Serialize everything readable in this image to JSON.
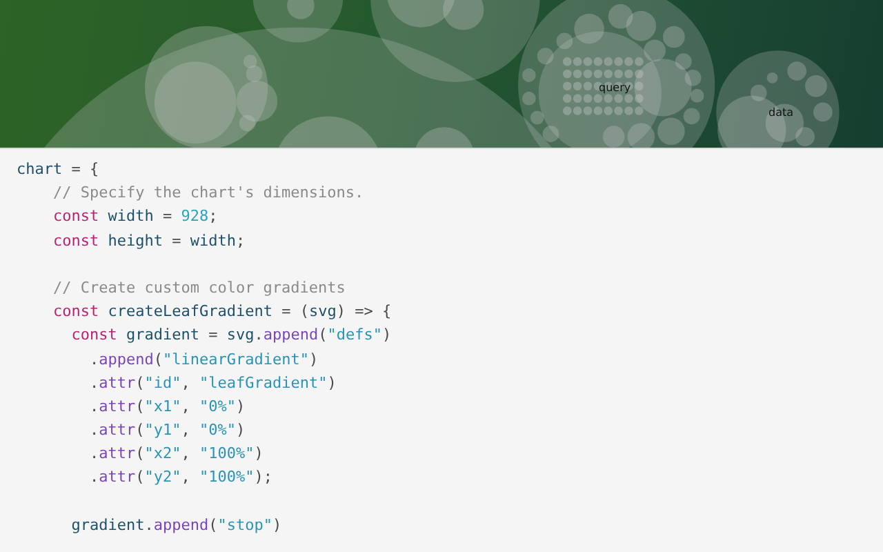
{
  "chart_labels": [
    {
      "text": "query"
    },
    {
      "text": "data"
    }
  ],
  "code_lines": [
    {
      "kind": "code",
      "tokens": [
        {
          "kind": "name",
          "text": "chart"
        },
        {
          "kind": "punct",
          "text": " = {"
        }
      ]
    },
    {
      "kind": "code",
      "tokens": [
        {
          "kind": "comment",
          "text": "    // Specify the chart's dimensions."
        }
      ]
    },
    {
      "kind": "code",
      "tokens": [
        {
          "kind": "keyword",
          "text": "    const"
        },
        {
          "kind": "name",
          "text": " width"
        },
        {
          "kind": "punct",
          "text": " = "
        },
        {
          "kind": "number",
          "text": "928"
        },
        {
          "kind": "punct",
          "text": ";"
        }
      ]
    },
    {
      "kind": "code",
      "tokens": [
        {
          "kind": "keyword",
          "text": "    const"
        },
        {
          "kind": "name",
          "text": " height"
        },
        {
          "kind": "punct",
          "text": " = "
        },
        {
          "kind": "name",
          "text": "width"
        },
        {
          "kind": "punct",
          "text": ";"
        }
      ]
    },
    {
      "kind": "blank"
    },
    {
      "kind": "code",
      "tokens": [
        {
          "kind": "comment",
          "text": "    // Create custom color gradients"
        }
      ]
    },
    {
      "kind": "code",
      "tokens": [
        {
          "kind": "keyword",
          "text": "    const"
        },
        {
          "kind": "name",
          "text": " createLeafGradient"
        },
        {
          "kind": "punct",
          "text": " = ("
        },
        {
          "kind": "name",
          "text": "svg"
        },
        {
          "kind": "punct",
          "text": ") => {"
        }
      ]
    },
    {
      "kind": "code",
      "tokens": [
        {
          "kind": "keyword",
          "text": "      const"
        },
        {
          "kind": "name",
          "text": " gradient"
        },
        {
          "kind": "punct",
          "text": " = "
        },
        {
          "kind": "name",
          "text": "svg"
        },
        {
          "kind": "punct",
          "text": "."
        },
        {
          "kind": "method",
          "text": "append"
        },
        {
          "kind": "punct",
          "text": "("
        },
        {
          "kind": "string",
          "text": "\"defs\""
        },
        {
          "kind": "punct",
          "text": ")"
        }
      ]
    },
    {
      "kind": "code",
      "tokens": [
        {
          "kind": "punct",
          "text": "        ."
        },
        {
          "kind": "method",
          "text": "append"
        },
        {
          "kind": "punct",
          "text": "("
        },
        {
          "kind": "string",
          "text": "\"linearGradient\""
        },
        {
          "kind": "punct",
          "text": ")"
        }
      ]
    },
    {
      "kind": "code",
      "tokens": [
        {
          "kind": "punct",
          "text": "        ."
        },
        {
          "kind": "method",
          "text": "attr"
        },
        {
          "kind": "punct",
          "text": "("
        },
        {
          "kind": "string",
          "text": "\"id\""
        },
        {
          "kind": "punct",
          "text": ", "
        },
        {
          "kind": "string",
          "text": "\"leafGradient\""
        },
        {
          "kind": "punct",
          "text": ")"
        }
      ]
    },
    {
      "kind": "code",
      "tokens": [
        {
          "kind": "punct",
          "text": "        ."
        },
        {
          "kind": "method",
          "text": "attr"
        },
        {
          "kind": "punct",
          "text": "("
        },
        {
          "kind": "string",
          "text": "\"x1\""
        },
        {
          "kind": "punct",
          "text": ", "
        },
        {
          "kind": "string",
          "text": "\"0%\""
        },
        {
          "kind": "punct",
          "text": ")"
        }
      ]
    },
    {
      "kind": "code",
      "tokens": [
        {
          "kind": "punct",
          "text": "        ."
        },
        {
          "kind": "method",
          "text": "attr"
        },
        {
          "kind": "punct",
          "text": "("
        },
        {
          "kind": "string",
          "text": "\"y1\""
        },
        {
          "kind": "punct",
          "text": ", "
        },
        {
          "kind": "string",
          "text": "\"0%\""
        },
        {
          "kind": "punct",
          "text": ")"
        }
      ]
    },
    {
      "kind": "code",
      "tokens": [
        {
          "kind": "punct",
          "text": "        ."
        },
        {
          "kind": "method",
          "text": "attr"
        },
        {
          "kind": "punct",
          "text": "("
        },
        {
          "kind": "string",
          "text": "\"x2\""
        },
        {
          "kind": "punct",
          "text": ", "
        },
        {
          "kind": "string",
          "text": "\"100%\""
        },
        {
          "kind": "punct",
          "text": ")"
        }
      ]
    },
    {
      "kind": "code",
      "tokens": [
        {
          "kind": "punct",
          "text": "        ."
        },
        {
          "kind": "method",
          "text": "attr"
        },
        {
          "kind": "punct",
          "text": "("
        },
        {
          "kind": "string",
          "text": "\"y2\""
        },
        {
          "kind": "punct",
          "text": ", "
        },
        {
          "kind": "string",
          "text": "\"100%\""
        },
        {
          "kind": "punct",
          "text": ");"
        }
      ]
    },
    {
      "kind": "blank"
    },
    {
      "kind": "code",
      "tokens": [
        {
          "kind": "name",
          "text": "      gradient"
        },
        {
          "kind": "punct",
          "text": "."
        },
        {
          "kind": "method",
          "text": "append"
        },
        {
          "kind": "punct",
          "text": "("
        },
        {
          "kind": "string",
          "text": "\"stop\""
        },
        {
          "kind": "punct",
          "text": ")"
        }
      ]
    }
  ]
}
